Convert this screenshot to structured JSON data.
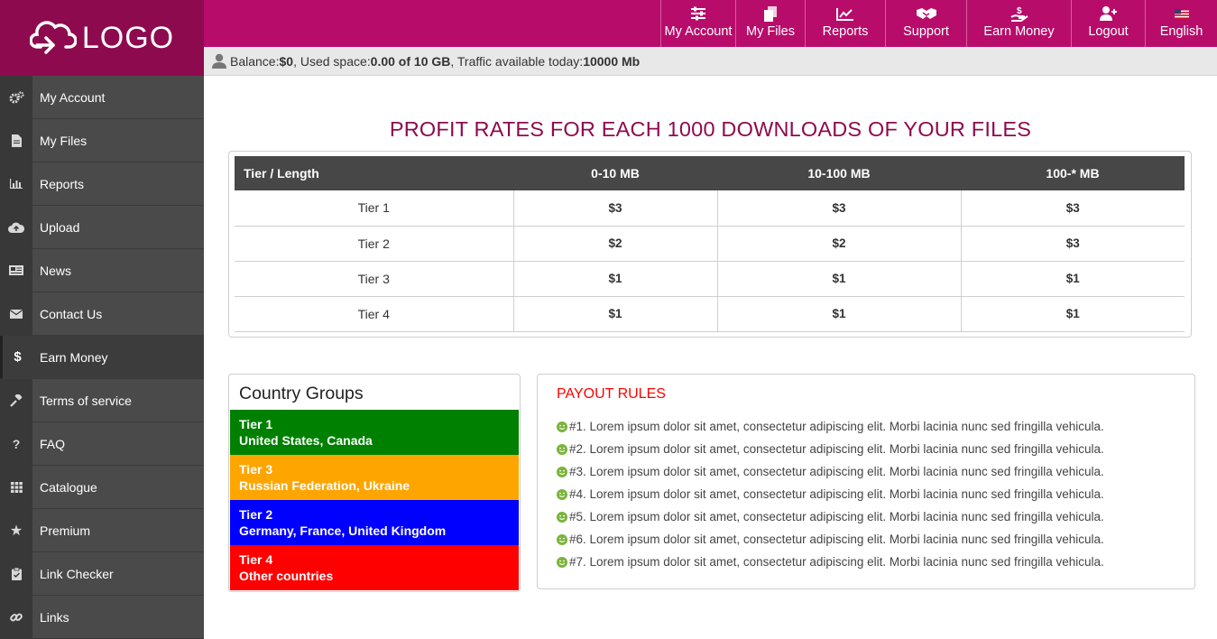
{
  "logo": {
    "text": "LOGO"
  },
  "topnav": [
    {
      "label": "My Account",
      "icon": "sliders-icon"
    },
    {
      "label": "My Files",
      "icon": "files-icon"
    },
    {
      "label": "Reports",
      "icon": "chart-icon"
    },
    {
      "label": "Support",
      "icon": "handshake-icon"
    },
    {
      "label": "Earn Money",
      "icon": "hand-dollar-icon"
    },
    {
      "label": "Logout",
      "icon": "user-plus-icon"
    },
    {
      "label": "English",
      "icon": "us-flag-icon"
    }
  ],
  "balance": {
    "balance_label": "Balance: ",
    "balance_value": "$0",
    "used_label": ", Used space: ",
    "used_value": "0.00 of 10 GB",
    "traffic_label": ", Traffic available today: ",
    "traffic_value": "10000 Mb"
  },
  "sidebar": [
    {
      "label": "My Account",
      "icon": "cogs-icon"
    },
    {
      "label": "My Files",
      "icon": "file-icon"
    },
    {
      "label": "Reports",
      "icon": "bar-chart-icon"
    },
    {
      "label": "Upload",
      "icon": "cloud-upload-icon"
    },
    {
      "label": "News",
      "icon": "newspaper-icon"
    },
    {
      "label": "Contact Us",
      "icon": "envelope-icon"
    },
    {
      "label": "Earn Money",
      "icon": "dollar-icon",
      "glyph": "$"
    },
    {
      "label": "Terms of service",
      "icon": "gavel-icon"
    },
    {
      "label": "FAQ",
      "icon": "question-icon",
      "glyph": "?"
    },
    {
      "label": "Catalogue",
      "icon": "grid-icon"
    },
    {
      "label": "Premium",
      "icon": "star-icon",
      "glyph": "★"
    },
    {
      "label": "Link Checker",
      "icon": "clipboard-check-icon"
    },
    {
      "label": "Links",
      "icon": "link-icon"
    }
  ],
  "page_title": "PROFIT RATES FOR EACH 1000 DOWNLOADS OF YOUR FILES",
  "rates_table": {
    "headers": [
      "Tier / Length",
      "0-10 MB",
      "10-100 MB",
      "100-* MB"
    ],
    "rows": [
      [
        "Tier 1",
        "$3",
        "$3",
        "$3"
      ],
      [
        "Tier 2",
        "$2",
        "$2",
        "$3"
      ],
      [
        "Tier 3",
        "$1",
        "$1",
        "$1"
      ],
      [
        "Tier 4",
        "$1",
        "$1",
        "$1"
      ]
    ]
  },
  "country_groups": {
    "title": "Country Groups",
    "groups": [
      {
        "tier": "Tier 1",
        "countries": "United States, Canada",
        "color": "#008000"
      },
      {
        "tier": "Tier 3",
        "countries": "Russian Federation, Ukraine",
        "color": "#ffa500"
      },
      {
        "tier": "Tier 2",
        "countries": "Germany, France, United Kingdom",
        "color": "#0000ff"
      },
      {
        "tier": "Tier 4",
        "countries": "Other countries",
        "color": "#ff0000"
      }
    ]
  },
  "payout_rules": {
    "title": "PAYOUT RULES",
    "rules": [
      "#1. Lorem ipsum dolor sit amet, consectetur adipiscing elit. Morbi lacinia nunc sed fringilla vehicula.",
      "#2. Lorem ipsum dolor sit amet, consectetur adipiscing elit. Morbi lacinia nunc sed fringilla vehicula.",
      "#3. Lorem ipsum dolor sit amet, consectetur adipiscing elit. Morbi lacinia nunc sed fringilla vehicula.",
      "#4. Lorem ipsum dolor sit amet, consectetur adipiscing elit. Morbi lacinia nunc sed fringilla vehicula.",
      "#5. Lorem ipsum dolor sit amet, consectetur adipiscing elit. Morbi lacinia nunc sed fringilla vehicula.",
      "#6. Lorem ipsum dolor sit amet, consectetur adipiscing elit. Morbi lacinia nunc sed fringilla vehicula.",
      "#7. Lorem ipsum dolor sit amet, consectetur adipiscing elit. Morbi lacinia nunc sed fringilla vehicula."
    ]
  },
  "colors": {
    "brand_dark": "#8e0a4f",
    "brand": "#b80c6b",
    "sidebar": "#4a4a4a",
    "rule_red": "#ff0000",
    "smile_green": "#7ab43a"
  }
}
